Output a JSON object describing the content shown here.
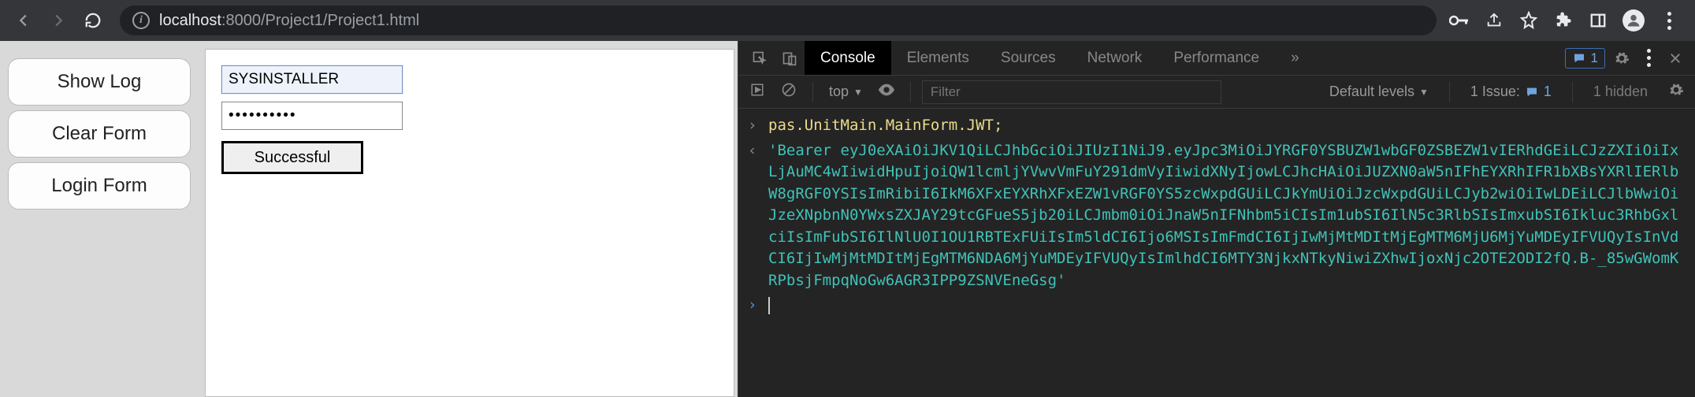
{
  "browser": {
    "url_host": "localhost",
    "url_port": ":8000",
    "url_path": "/Project1/Project1.html"
  },
  "page": {
    "buttons": {
      "show_log": "Show Log",
      "clear_form": "Clear Form",
      "login_form": "Login Form"
    },
    "form": {
      "username_value": "SYSINSTALLER",
      "password_value": "••••••••••",
      "success_label": "Successful"
    }
  },
  "devtools": {
    "tabs": {
      "console": "Console",
      "elements": "Elements",
      "sources": "Sources",
      "network": "Network",
      "performance": "Performance",
      "more": "»"
    },
    "issues_count": "1",
    "toolbar": {
      "context": "top",
      "filter_placeholder": "Filter",
      "levels": "Default levels",
      "issue_label": "1 Issue:",
      "issue_count": "1",
      "hidden": "1 hidden"
    },
    "console": {
      "input_cmd": "pas.UnitMain.MainForm.JWT;",
      "output_str": "'Bearer eyJ0eXAiOiJKV1QiLCJhbGciOiJIUzI1NiJ9.eyJpc3MiOiJYRGF0YSBUZW1wbGF0ZSBEZW1vIERhdGEiLCJzZXIiOiIxLjAuMC4wIiwidHpuIjoiQW1lcmljYVwvVmFuY291dmVyIiwidXNyIjowLCJhcHAiOiJUZXN0aW5nIFhEYXRhIFR1bXBsYXRlIERlbW8gRGF0YSIsImRibiI6IkM6XFxEYXRhXFxEZW1vRGF0YS5zcWxpdGUiLCJkYmUiOiJzcWxpdGUiLCJyb2wiOiIwLDEiLCJlbWwiOiJzeXNpbnN0YWxsZXJAY29tcGFueS5jb20iLCJmbm0iOiJnaW5nIFNhbm5iCIsIm1ubSI6IlN5c3RlbSIsImxubSI6Ikluc3RhbGxlciIsImFubSI6IlNlU0I1OU1RBTExFUiIsIm5ldCI6Ijo6MSIsImFmdCI6IjIwMjMtMDItMjEgMTM6MjU6MjYuMDEyIFVUQyIsInVdCI6IjIwMjMtMDItMjEgMTM6NDA6MjYuMDEyIFVUQyIsImlhdCI6MTY3NjkxNTkyNiwiZXhwIjoxNjc2OTE2ODI2fQ.B-_85wGWomKRPbsjFmpqNoGw6AGR3IPP9ZSNVEneGsg'"
    }
  }
}
